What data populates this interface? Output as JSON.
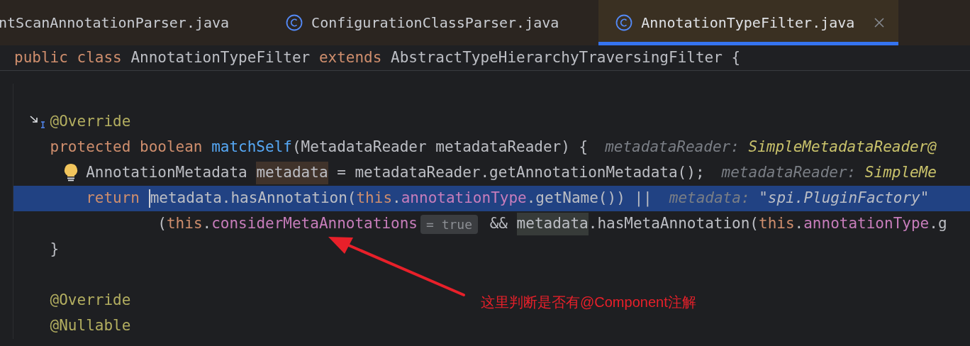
{
  "tabs": [
    {
      "label": "ntScanAnnotationParser.java",
      "icon": false,
      "selected": false,
      "close": false
    },
    {
      "label": "ConfigurationClassParser.java",
      "icon": true,
      "selected": false,
      "close": false
    },
    {
      "label": "AnnotationTypeFilter.java",
      "icon": true,
      "selected": true,
      "close": true
    }
  ],
  "sticky_header": [
    {
      "text": "public class ",
      "kind": "keyword"
    },
    {
      "text": "AnnotationTypeFilter ",
      "kind": "plain"
    },
    {
      "text": "extends ",
      "kind": "keyword"
    },
    {
      "text": "AbstractTypeHierarchyTraversingFilter {",
      "kind": "plain"
    }
  ],
  "lines": [
    {
      "kind": "plain",
      "selected": false
    },
    {
      "kind": "overrides",
      "selected": false,
      "tokens": [
        {
          "text": "    @Override",
          "kind": "annotation"
        }
      ]
    },
    {
      "kind": "plain",
      "selected": false,
      "tokens": [
        {
          "text": "    protected boolean ",
          "kind": "keyword"
        },
        {
          "text": "matchSelf",
          "kind": "method"
        },
        {
          "text": "(MetadataReader metadataReader) {",
          "kind": "plain"
        },
        {
          "text": "metadataReader: ",
          "kind": "hint"
        },
        {
          "text": "SimpleMetadataReader@",
          "kind": "hint_value"
        }
      ]
    },
    {
      "kind": "bulb",
      "selected": false,
      "tokens": [
        {
          "text": "        AnnotationMetadata ",
          "kind": "plain"
        },
        {
          "text": "metadata",
          "kind": "write_highlight"
        },
        {
          "text": " = metadataReader.getAnnotationMetadata();",
          "kind": "plain"
        },
        {
          "text": "metadataReader: ",
          "kind": "hint"
        },
        {
          "text": "SimpleMe",
          "kind": "hint_value"
        }
      ]
    },
    {
      "kind": "plain",
      "selected": true,
      "tokens": [
        {
          "text": "        return ",
          "kind": "keyword"
        },
        {
          "text": "metadata.hasAnnotation(",
          "kind": "plain"
        },
        {
          "text": "this",
          "kind": "keyword"
        },
        {
          "text": ".",
          "kind": "plain"
        },
        {
          "text": "annotationType",
          "kind": "field"
        },
        {
          "text": ".getName()) ||",
          "kind": "plain"
        },
        {
          "text": "metadata: ",
          "kind": "hint"
        },
        {
          "text": "\"spi.PluginFactory\"",
          "kind": "hint_string"
        }
      ]
    },
    {
      "kind": "plain",
      "selected": false,
      "tokens": [
        {
          "text": "                (",
          "kind": "plain"
        },
        {
          "text": "this",
          "kind": "keyword"
        },
        {
          "text": ".",
          "kind": "plain"
        },
        {
          "text": "considerMetaAnnotations",
          "kind": "field"
        },
        {
          "text": "= true",
          "kind": "chip"
        },
        {
          "text": " && ",
          "kind": "plain"
        },
        {
          "text": "metadata",
          "kind": "read_highlight"
        },
        {
          "text": ".hasMetaAnnotation(",
          "kind": "plain"
        },
        {
          "text": "this",
          "kind": "keyword"
        },
        {
          "text": ".",
          "kind": "plain"
        },
        {
          "text": "annotationType",
          "kind": "field"
        },
        {
          "text": ".g",
          "kind": "plain"
        }
      ]
    },
    {
      "kind": "plain",
      "selected": false,
      "tokens": [
        {
          "text": "    }",
          "kind": "plain"
        }
      ]
    },
    {
      "kind": "plain",
      "selected": false
    },
    {
      "kind": "plain",
      "selected": false,
      "tokens": [
        {
          "text": "    @Override",
          "kind": "annotation"
        }
      ]
    },
    {
      "kind": "plain",
      "selected": false,
      "tokens": [
        {
          "text": "    @Nullable",
          "kind": "annotation"
        }
      ]
    }
  ],
  "callout": {
    "text": "这里判断是否有@Component注解"
  }
}
